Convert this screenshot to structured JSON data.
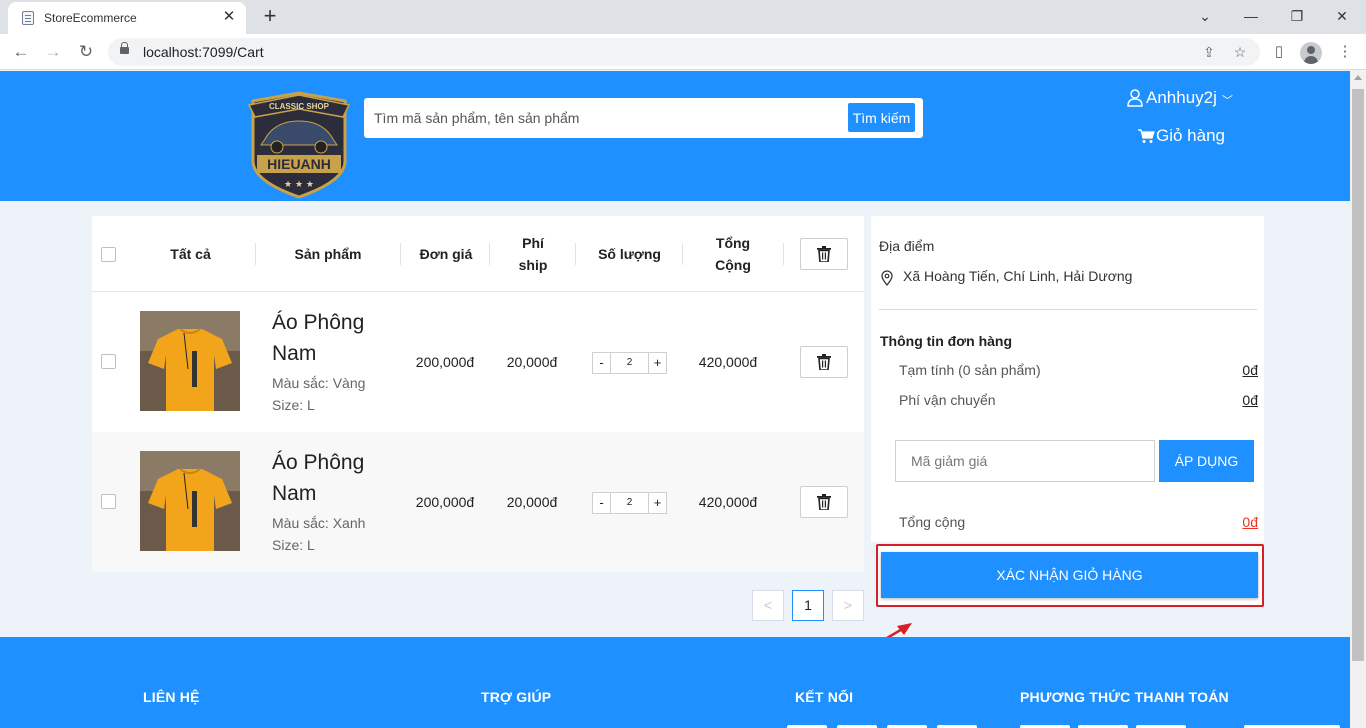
{
  "browser": {
    "tab_title": "StoreEcommerce",
    "url": "localhost:7099/Cart"
  },
  "header": {
    "logo_text": {
      "top": "CLASSIC SHOP",
      "main": "HIEUANH"
    },
    "search_placeholder": "Tìm mã sản phẩm, tên sản phẩm",
    "search_button": "Tìm kiếm",
    "username": "Anhhuy2j",
    "cart_label": "Giỏ hàng"
  },
  "cart": {
    "columns": {
      "all": "Tất cả",
      "product": "Sản phẩm",
      "unit_price": "Đơn giá",
      "ship_fee_1": "Phí",
      "ship_fee_2": "ship",
      "quantity": "Số lượng",
      "total_1": "Tổng",
      "total_2": "Cộng"
    },
    "items": [
      {
        "name_1": "Áo Phông",
        "name_2": "Nam",
        "color": "Màu sắc: Vàng",
        "size": "Size: L",
        "unit_price": "200,000đ",
        "ship_fee": "20,000đ",
        "quantity": "2",
        "total": "420,000đ",
        "dec": "-",
        "inc": "+"
      },
      {
        "name_1": "Áo Phông",
        "name_2": "Nam",
        "color": "Màu sắc: Xanh",
        "size": "Size: L",
        "unit_price": "200,000đ",
        "ship_fee": "20,000đ",
        "quantity": "2",
        "total": "420,000đ",
        "dec": "-",
        "inc": "+"
      }
    ],
    "pagination": {
      "prev": "<",
      "current": "1",
      "next": ">"
    }
  },
  "summary": {
    "location_label": "Địa điểm",
    "address": "Xã Hoàng Tiến, Chí Linh, Hải Dương",
    "order_info_title": "Thông tin đơn hàng",
    "subtotal_label": "Tạm tính (0 sản phẩm)",
    "subtotal_value": "0đ",
    "shipping_label": "Phí vận chuyển",
    "shipping_value": "0đ",
    "coupon_placeholder": "Mã giảm giá",
    "apply_button": "ÁP DỤNG",
    "total_label": "Tổng cộng",
    "total_value": "0đ",
    "confirm_button": "XÁC NHẬN GIỎ HÀNG"
  },
  "footer": {
    "contact": "LIÊN HỆ",
    "help": "TRỢ GIÚP",
    "connect": "KẾT NỐI",
    "payment": "PHƯƠNG THỨC THANH TOÁN"
  },
  "colors": {
    "brand_blue": "#1e90ff",
    "highlight_red": "#d61f26",
    "price_red": "#e32222"
  }
}
